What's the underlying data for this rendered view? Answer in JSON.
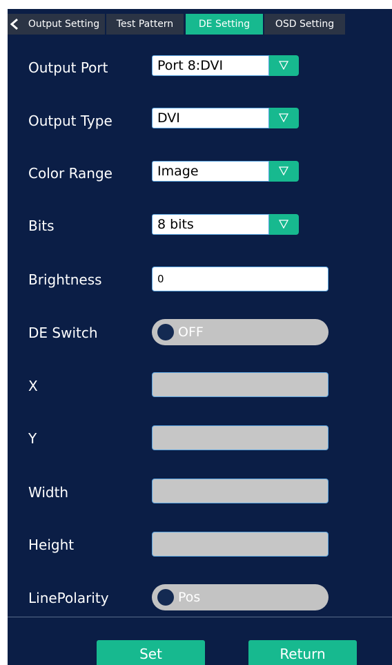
{
  "tabs": [
    {
      "label": "Output Setting",
      "active": false
    },
    {
      "label": "Test Pattern",
      "active": false
    },
    {
      "label": "DE Setting",
      "active": true
    },
    {
      "label": "OSD Setting",
      "active": false
    }
  ],
  "icons": {
    "back": "chevron-left-icon",
    "dropdown": "triangle-down-icon"
  },
  "form": {
    "output_port": {
      "label": "Output Port",
      "value": "Port 8:DVI"
    },
    "output_type": {
      "label": "Output Type",
      "value": "DVI"
    },
    "color_range": {
      "label": "Color Range",
      "value": "Image"
    },
    "bits": {
      "label": "Bits",
      "value": "8 bits"
    },
    "brightness": {
      "label": "Brightness",
      "value": "0"
    },
    "de_switch": {
      "label": "DE Switch",
      "state": "OFF"
    },
    "x": {
      "label": "X",
      "value": ""
    },
    "y": {
      "label": "Y",
      "value": ""
    },
    "width": {
      "label": "Width",
      "value": ""
    },
    "height": {
      "label": "Height",
      "value": ""
    },
    "line_polarity": {
      "label": "LinePolarity",
      "state": "Pos"
    }
  },
  "buttons": {
    "set": "Set",
    "return": "Return"
  },
  "colors": {
    "background": "#0b1e46",
    "accent": "#17b98f",
    "tab_inactive": "#2b3445",
    "field_disabled": "#c6c6c6",
    "toggle_off": "#c3c3c3",
    "field_border": "#5ba5e0"
  }
}
